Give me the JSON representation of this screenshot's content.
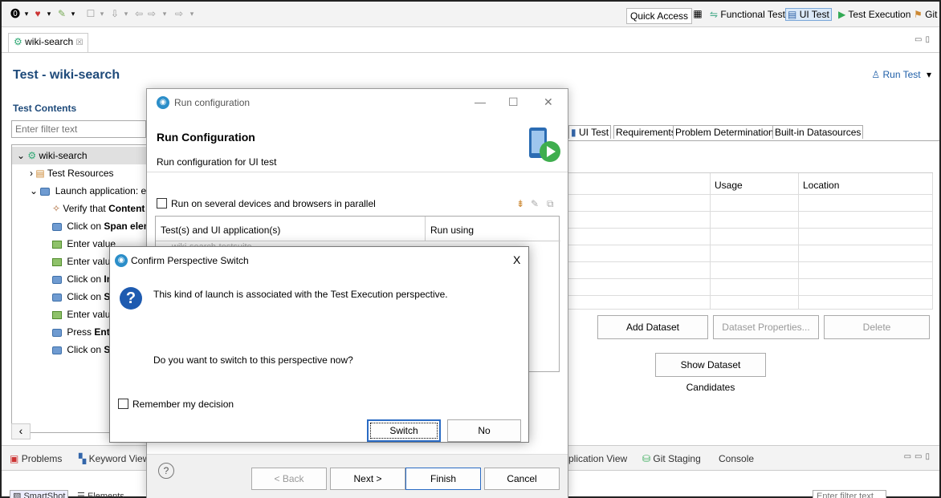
{
  "toolbar": {
    "quick_access": "Quick Access",
    "perspectives": [
      {
        "label": "Functional Test",
        "icon": "functional-test-icon"
      },
      {
        "label": "UI Test",
        "icon": "ui-test-icon"
      },
      {
        "label": "Test Execution",
        "icon": "test-execution-icon"
      },
      {
        "label": "Git",
        "icon": "git-icon"
      }
    ]
  },
  "editor": {
    "tab_label": "wiki-search",
    "tab_close": "☒",
    "title": "Test - wiki-search",
    "run_test": "Run Test"
  },
  "test_contents": {
    "title": "Test Contents",
    "filter_placeholder": "Enter filter text",
    "tree": [
      {
        "text": "wiki-search",
        "bold": ""
      },
      {
        "text": "Test Resources",
        "bold": ""
      },
      {
        "text": "Launch application: en.",
        "bold": ""
      },
      {
        "text": "Verify that ",
        "bold": "Content"
      },
      {
        "text": "Click on ",
        "bold": "Span eleme"
      },
      {
        "text": "Enter value",
        "bold": ""
      },
      {
        "text": "Enter value",
        "bold": ""
      },
      {
        "text": "Click on ",
        "bold": "In"
      },
      {
        "text": "Click on ",
        "bold": "Se"
      },
      {
        "text": "Enter value",
        "bold": ""
      },
      {
        "text": "Press ",
        "bold": "Ente"
      },
      {
        "text": "Click on ",
        "bold": "Sp"
      }
    ]
  },
  "right_panel": {
    "tabs": [
      "UI Test",
      "Requirements",
      "Problem Determination",
      "Built-in Datasources"
    ],
    "columns": [
      "Usage",
      "Location"
    ],
    "add_dataset": "Add Dataset",
    "dataset_properties": "Dataset Properties...",
    "delete": "Delete",
    "show_candidates": "Show Dataset Candidates"
  },
  "bottom": {
    "tabs": [
      "Problems",
      "Keyword View",
      "plication View",
      "Git Staging",
      "Console"
    ],
    "sub_tabs": [
      "SmartShot",
      "Elements"
    ],
    "filter_placeholder": "Enter filter text"
  },
  "run_config": {
    "window_title": "Run configuration",
    "header_title": "Run Configuration",
    "header_subtitle": "Run configuration for UI test",
    "parallel_label": "Run on several devices and browsers in parallel",
    "col1": "Test(s) and UI application(s)",
    "col2": "Run using",
    "row1": "wiki-search-testsuite",
    "back": "< Back",
    "next": "Next >",
    "finish": "Finish",
    "cancel": "Cancel",
    "help": "?"
  },
  "confirm": {
    "title": "Confirm Perspective Switch",
    "message": "This kind of launch is associated with the Test Execution perspective.",
    "question": "Do you want to switch to this perspective now?",
    "remember": "Remember my decision",
    "switch": "Switch",
    "no": "No",
    "close": "X"
  }
}
